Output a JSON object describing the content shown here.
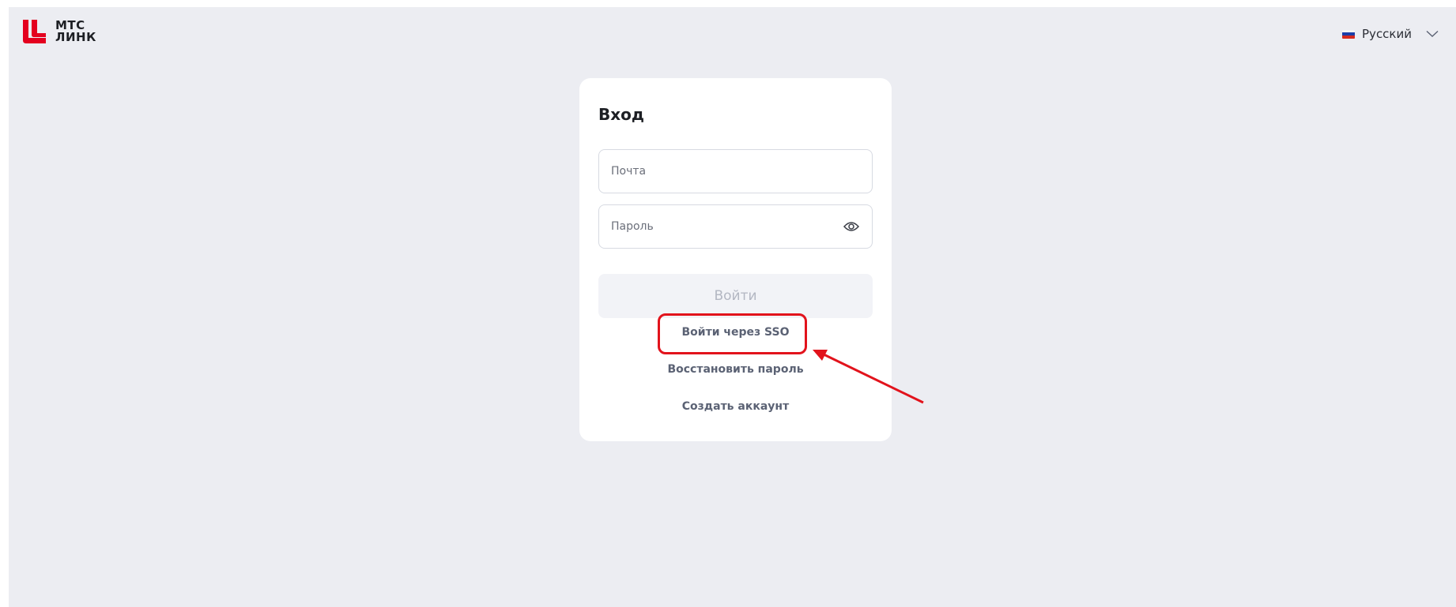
{
  "brand": {
    "logo_line1": "МТС",
    "logo_line2": "ЛИНК",
    "color": "#e4001f"
  },
  "language": {
    "selected": "Русский",
    "flag_colors": [
      "#ffffff",
      "#1c3fa8",
      "#d52b1e"
    ]
  },
  "login": {
    "title": "Вход",
    "email_placeholder": "Почта",
    "password_placeholder": "Пароль",
    "submit_label": "Войти",
    "sso_label": "Войти через SSO",
    "restore_label": "Восстановить пароль",
    "register_label": "Создать аккаунт"
  },
  "annotation": {
    "color": "#e2131c"
  }
}
